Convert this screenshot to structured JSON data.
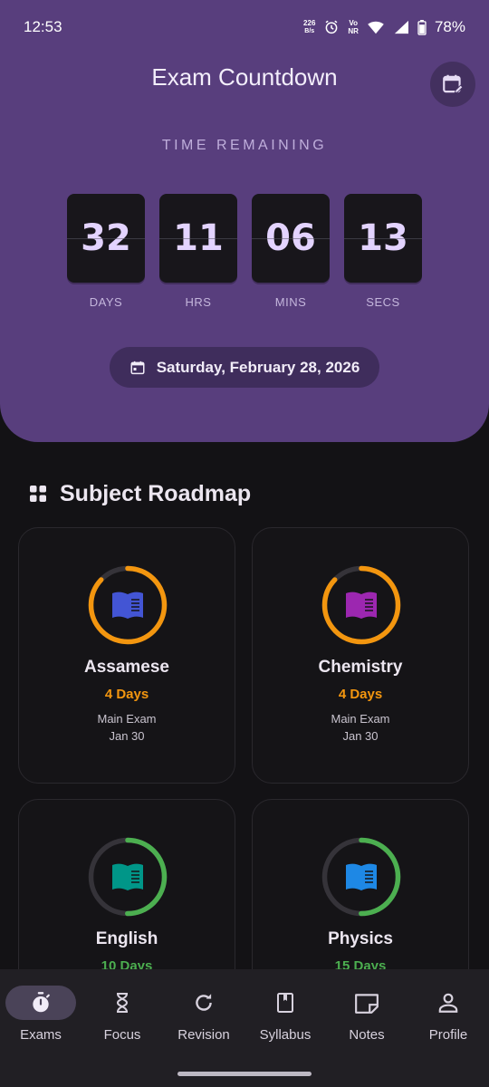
{
  "status": {
    "time": "12:53",
    "net_speed": "226",
    "net_unit": "B/s",
    "volte": "Vo",
    "nr": "NR",
    "battery": "78%"
  },
  "header": {
    "title": "Exam Countdown",
    "calendar_icon": "calendar-edit-icon",
    "time_remaining_label": "TIME REMAINING"
  },
  "countdown": {
    "days": "32",
    "hrs": "11",
    "mins": "06",
    "secs": "13",
    "days_label": "DAYS",
    "hrs_label": "HRS",
    "mins_label": "MINS",
    "secs_label": "SECS"
  },
  "exam_date": "Saturday, February 28, 2026",
  "roadmap": {
    "title": "Subject Roadmap",
    "subjects": [
      {
        "name": "Assamese",
        "days": "4 Days",
        "exam": "Main Exam",
        "date": "Jan 30",
        "progress": 0.87,
        "ring_color": "#f3960f",
        "icon_color": "#4355d4",
        "days_color": "#f3960f"
      },
      {
        "name": "Chemistry",
        "days": "4 Days",
        "exam": "Main Exam",
        "date": "Jan 30",
        "progress": 0.87,
        "ring_color": "#f3960f",
        "icon_color": "#9c27b0",
        "days_color": "#f3960f"
      },
      {
        "name": "English",
        "days": "10 Days",
        "exam": "",
        "date": "",
        "progress": 0.5,
        "ring_color": "#4caf50",
        "icon_color": "#009688",
        "days_color": "#4caf50"
      },
      {
        "name": "Physics",
        "days": "15 Days",
        "exam": "",
        "date": "",
        "progress": 0.5,
        "ring_color": "#4caf50",
        "icon_color": "#1e88e5",
        "days_color": "#4caf50"
      }
    ]
  },
  "nav": {
    "items": [
      {
        "label": "Exams",
        "icon": "stopwatch-icon",
        "active": true
      },
      {
        "label": "Focus",
        "icon": "hourglass-icon",
        "active": false
      },
      {
        "label": "Revision",
        "icon": "refresh-icon",
        "active": false
      },
      {
        "label": "Syllabus",
        "icon": "book-icon",
        "active": false
      },
      {
        "label": "Notes",
        "icon": "note-icon",
        "active": false
      },
      {
        "label": "Profile",
        "icon": "person-icon",
        "active": false
      }
    ]
  }
}
